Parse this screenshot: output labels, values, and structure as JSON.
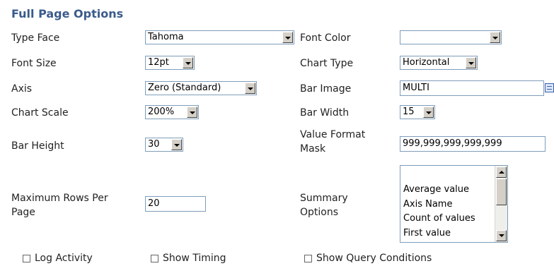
{
  "title": "Full Page Options",
  "fields": {
    "type_face": {
      "label": "Type Face",
      "value": "Tahoma"
    },
    "font_color": {
      "label": "Font Color",
      "value": ""
    },
    "font_size": {
      "label": "Font Size",
      "value": "12pt"
    },
    "chart_type": {
      "label": "Chart Type",
      "value": "Horizontal"
    },
    "axis": {
      "label": "Axis",
      "value": "Zero (Standard)"
    },
    "bar_image": {
      "label": "Bar Image",
      "value": "MULTI"
    },
    "chart_scale": {
      "label": "Chart Scale",
      "value": "200%"
    },
    "bar_width": {
      "label": "Bar Width",
      "value": "15"
    },
    "bar_height": {
      "label": "Bar Height",
      "value": "30"
    },
    "value_format_mask": {
      "label_line1": "Value Format",
      "label_line2": "Mask",
      "value": "999,999,999,999,999"
    },
    "max_rows": {
      "label_line1": "Maximum Rows Per",
      "label_line2": "Page",
      "value": "20"
    },
    "summary_options": {
      "label_line1": "Summary",
      "label_line2": "Options",
      "items": [
        "Average value",
        "Axis Name",
        "Count of values",
        "First value"
      ]
    }
  },
  "checkboxes": {
    "log_activity": {
      "label": "Log Activity",
      "checked": false
    },
    "show_timing": {
      "label": "Show Timing",
      "checked": false
    },
    "show_query_conditions": {
      "label": "Show Query Conditions",
      "checked": false
    }
  }
}
